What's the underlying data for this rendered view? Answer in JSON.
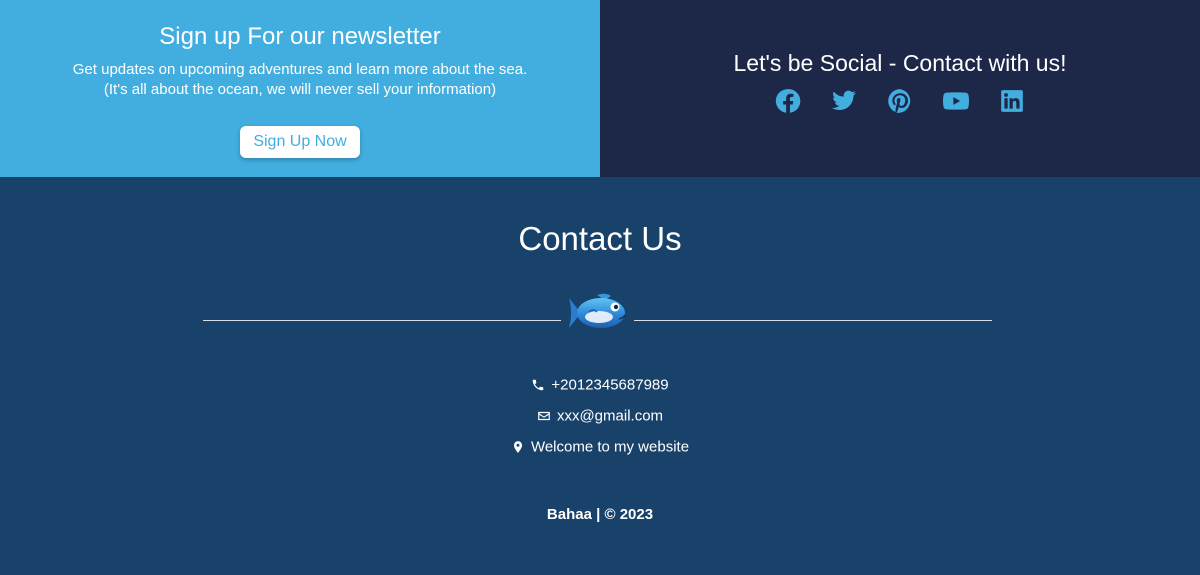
{
  "newsletter": {
    "title": "Sign up For our newsletter",
    "line1": "Get updates on upcoming adventures and learn more about the sea.",
    "line2": "(It's all about the ocean, we will never sell your information)",
    "button_label": "Sign Up Now",
    "bg_color": "#42aee0"
  },
  "social": {
    "title": "Let's be Social - Contact with us!",
    "icons": [
      "facebook-icon",
      "twitter-icon",
      "pinterest-icon",
      "youtube-icon",
      "linkedin-icon"
    ],
    "bg_color": "#1d2748",
    "icon_color": "#42aee0"
  },
  "contact": {
    "title": "Contact Us",
    "phone": "+2012345687989",
    "email": "xxx@gmail.com",
    "address": "Welcome to my website",
    "bg_color": "#18426a"
  },
  "footer": {
    "text": "Bahaa | © 2023"
  }
}
